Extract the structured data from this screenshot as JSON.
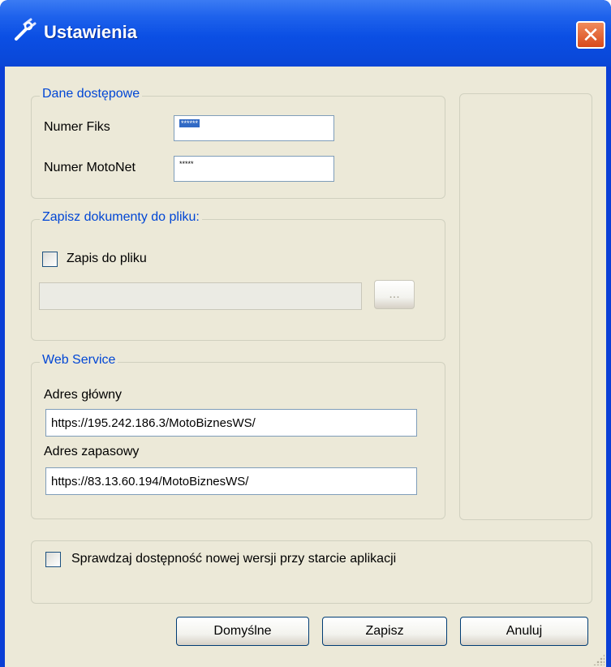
{
  "window": {
    "title": "Ustawienia",
    "close_label": "✕"
  },
  "access": {
    "legend": "Dane dostępowe",
    "fiks_label": "Numer Fiks",
    "fiks_value": "******",
    "motonet_label": "Numer MotoNet",
    "motonet_value": "*****"
  },
  "file_save": {
    "legend": "Zapisz dokumenty do pliku:",
    "checkbox_label": "Zapis do pliku",
    "path_value": "",
    "browse_label": "..."
  },
  "web_service": {
    "legend": "Web Service",
    "primary_label": "Adres główny",
    "primary_value": "https://195.242.186.3/MotoBiznesWS/",
    "backup_label": "Adres zapasowy",
    "backup_value": "https://83.13.60.194/MotoBiznesWS/"
  },
  "update_check": {
    "label": "Sprawdzaj dostępność nowej wersji przy starcie aplikacji"
  },
  "buttons": {
    "defaults": "Domyślne",
    "save": "Zapisz",
    "cancel": "Anuluj"
  },
  "colors": {
    "titlebar": "#0a4fe4",
    "legend_text": "#0046d5",
    "dialog_bg": "#ece9d8"
  },
  "icons": {
    "title": "settings-wrench-icon",
    "close": "close-icon"
  }
}
